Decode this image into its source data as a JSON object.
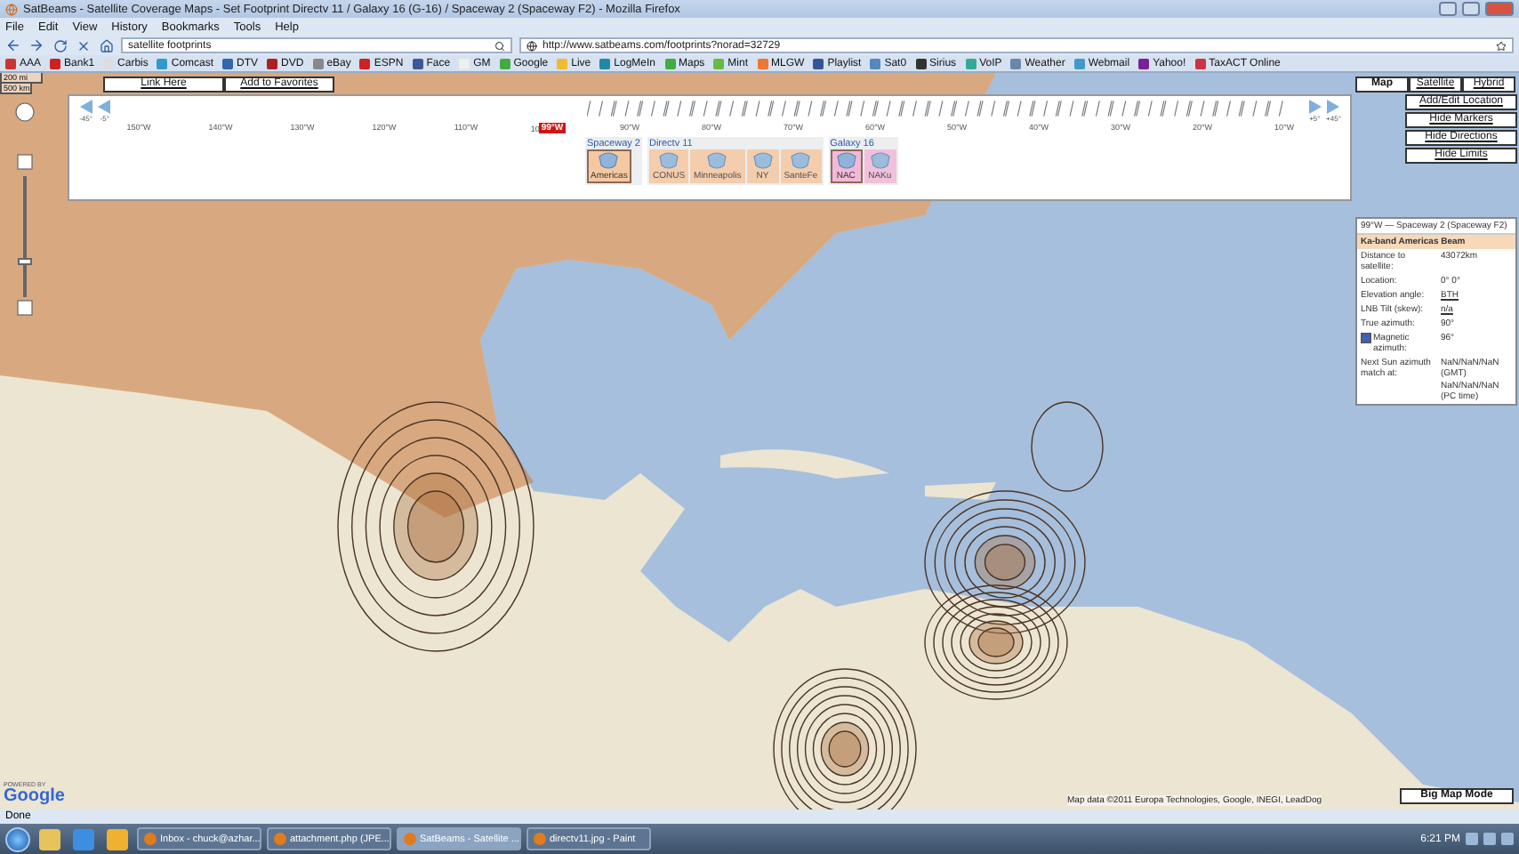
{
  "window": {
    "title": "SatBeams - Satellite Coverage Maps - Set Footprint Directv 11 / Galaxy 16 (G-16) / Spaceway 2 (Spaceway F2) - Mozilla Firefox"
  },
  "menu": [
    "File",
    "Edit",
    "View",
    "History",
    "Bookmarks",
    "Tools",
    "Help"
  ],
  "navigation": {
    "search": "satellite footprints",
    "url": "http://www.satbeams.com/footprints?norad=32729"
  },
  "bookmarks": [
    "AAA",
    "Bank1",
    "Carbis",
    "Comcast",
    "DTV",
    "DVD",
    "eBay",
    "ESPN",
    "Face",
    "GM",
    "Google",
    "Live",
    "LogMeIn",
    "Maps",
    "Mint",
    "MLGW",
    "Playlist",
    "Sat0",
    "Sirius",
    "VoIP",
    "Weather",
    "Webmail",
    "Yahoo!",
    "TaxACT Online"
  ],
  "page": {
    "scale": [
      "200 mi",
      "500 km"
    ],
    "zoom": {
      "level": 0.3
    },
    "top_links": [
      "Link Here",
      "Add to Favorites"
    ],
    "map_types": [
      {
        "label": "Map",
        "selected": true
      },
      {
        "label": "Satellite",
        "selected": false
      },
      {
        "label": "Hybrid",
        "selected": false
      }
    ],
    "actions": [
      "Add/Edit Location",
      "Hide Markers",
      "Hide Directions",
      "Hide Limits"
    ],
    "slider": {
      "left_steps": [
        "-45°",
        "-5°"
      ],
      "right_steps": [
        "+5°",
        "+45°"
      ],
      "ticks_before": [
        "150°W",
        "140°W",
        "130°W",
        "120°W",
        "110°W"
      ],
      "marker": {
        "covered_tick": "10",
        "label": "99°W"
      },
      "ticks_after": [
        "90°W",
        "80°W",
        "70°W",
        "60°W",
        "50°W",
        "40°W",
        "30°W",
        "20°W",
        "10°W"
      ],
      "groups": [
        {
          "name": "Spaceway 2",
          "color": "#f6c8a2",
          "beams": [
            {
              "label": "Americas",
              "selected": true
            }
          ]
        },
        {
          "name": "Directv 11",
          "color": "#f6c8a2",
          "beams": [
            {
              "label": "CONUS",
              "selected": false
            },
            {
              "label": "Minneapolis",
              "selected": false
            },
            {
              "label": "NY",
              "selected": false
            },
            {
              "label": "SanteFe",
              "selected": false
            }
          ]
        },
        {
          "name": "Galaxy 16",
          "color": "#f3b8d8",
          "beams": [
            {
              "label": "NAC",
              "selected": true
            },
            {
              "label": "NAKu",
              "selected": false
            }
          ]
        }
      ]
    },
    "info": {
      "title": "99°W — Spaceway 2 (Spaceway F2)",
      "beam": "Ka-band Americas Beam",
      "rows": [
        {
          "kind": "text",
          "label": "Distance to satellite:",
          "values": [
            "43072km"
          ]
        },
        {
          "kind": "text",
          "label": "Location:",
          "values": [
            "0° 0°"
          ]
        },
        {
          "kind": "link",
          "label": "Elevation angle:",
          "values": [
            "BTH"
          ]
        },
        {
          "kind": "link",
          "label": "LNB Tilt (skew):",
          "values": [
            "n/a"
          ]
        },
        {
          "kind": "text",
          "label": "True azimuth:",
          "values": [
            "90°"
          ]
        },
        {
          "kind": "check",
          "label": "Magnetic azimuth:",
          "checked": true,
          "values": [
            "96°"
          ]
        },
        {
          "kind": "text",
          "label": "Next Sun azimuth match at:",
          "values": [
            "NaN/NaN/NaN (GMT)",
            "NaN/NaN/NaN (PC time)"
          ]
        }
      ]
    },
    "powered_by": "POWERED BY",
    "logo": "Google",
    "attribution": "Map data ©2011 Europa Technologies, Google, INEGI, LeadDog",
    "big_map": "Big Map Mode"
  },
  "status": "Done",
  "taskbar": {
    "tasks": [
      {
        "label": "Inbox - chuck@azhar...",
        "selected": false
      },
      {
        "label": "attachment.php (JPE...",
        "selected": false
      },
      {
        "label": "SatBeams - Satellite ...",
        "selected": true
      },
      {
        "label": "directv11.jpg - Paint",
        "selected": false
      }
    ],
    "clock": "6:21 PM"
  }
}
